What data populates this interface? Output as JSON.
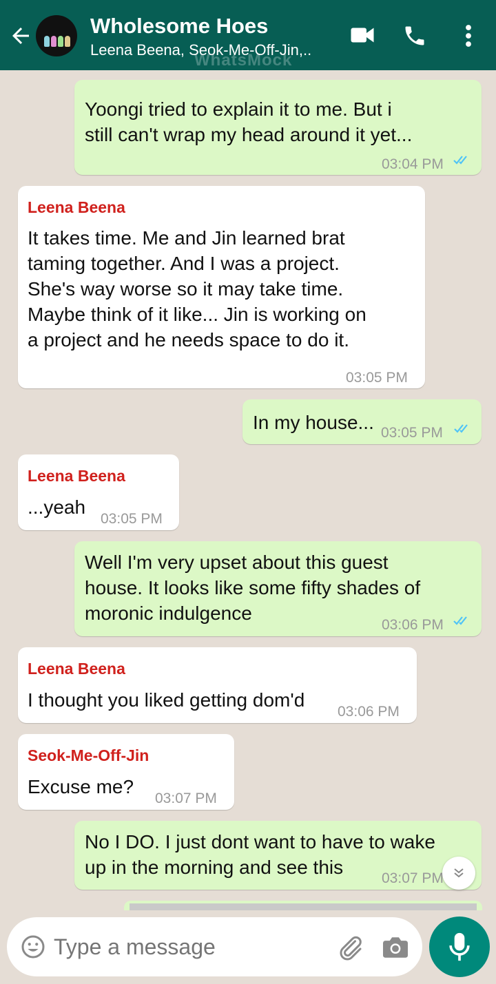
{
  "header": {
    "title": "Wholesome Hoes",
    "subtitle": "Leena Beena, Seok-Me-Off-Jin,..",
    "watermark": "WhatsMock",
    "colors": {
      "bar": "#075e54"
    }
  },
  "messages": [
    {
      "direction": "out",
      "text_lines": [
        "Yoongi tried to explain it to me. But i",
        "still can't wrap my head around it yet..."
      ],
      "time": "03:04 PM",
      "status": "read"
    },
    {
      "direction": "in",
      "sender": "Leena Beena",
      "text_lines": [
        "It takes time. Me and Jin learned brat",
        "taming together. And I was a project.",
        "She's way worse so it may take time.",
        "Maybe think of it like... Jin is working on",
        "a project and he needs space to do it."
      ],
      "time": "03:05 PM"
    },
    {
      "direction": "out",
      "text_lines": [
        "In my house..."
      ],
      "time": "03:05 PM",
      "status": "read"
    },
    {
      "direction": "in",
      "sender": "Leena Beena",
      "text_lines": [
        "...yeah"
      ],
      "time": "03:05 PM"
    },
    {
      "direction": "out",
      "text_lines": [
        "Well I'm very upset about this guest",
        "house. It looks like some fifty shades of",
        "moronic indulgence"
      ],
      "time": "03:06 PM",
      "status": "read"
    },
    {
      "direction": "in",
      "sender": "Leena Beena",
      "text_lines": [
        "I thought you liked getting dom'd"
      ],
      "time": "03:06 PM"
    },
    {
      "direction": "in",
      "sender": "Seok-Me-Off-Jin",
      "text_lines": [
        "Excuse me?"
      ],
      "time": "03:07 PM"
    },
    {
      "direction": "out",
      "text_lines": [
        "No I DO. I just dont want to have to wake",
        "up in the morning and see this"
      ],
      "time": "03:07 PM",
      "status": "read"
    }
  ],
  "composer": {
    "placeholder": "Type a message"
  },
  "icons": [
    "back-arrow-icon",
    "video-call-icon",
    "phone-icon",
    "more-vert-icon",
    "emoji-icon",
    "attach-icon",
    "camera-icon",
    "mic-icon",
    "double-chevron-down-icon"
  ],
  "colors": {
    "outgoing": "#dcf8c6",
    "incoming": "#ffffff",
    "sender": "#d0211d",
    "mic": "#00897b",
    "read_ticks": "#4fc3f7"
  }
}
